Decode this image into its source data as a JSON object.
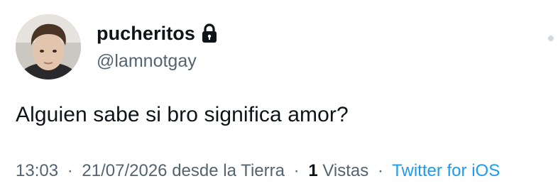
{
  "author": {
    "display_name": "pucheritos",
    "handle": "@lamnotgay",
    "protected_icon": "lock-icon"
  },
  "tweet": {
    "text": "Alguien sabe si bro significa amor?"
  },
  "meta": {
    "time": "13:03",
    "separator": "·",
    "date": "21/07/2026",
    "location": "desde la Tierra",
    "views_count": "1",
    "views_label": "Vistas",
    "source": "Twitter for iOS"
  },
  "colors": {
    "text_primary": "#0f1419",
    "text_secondary": "#536471",
    "link": "#1d9bf0"
  }
}
